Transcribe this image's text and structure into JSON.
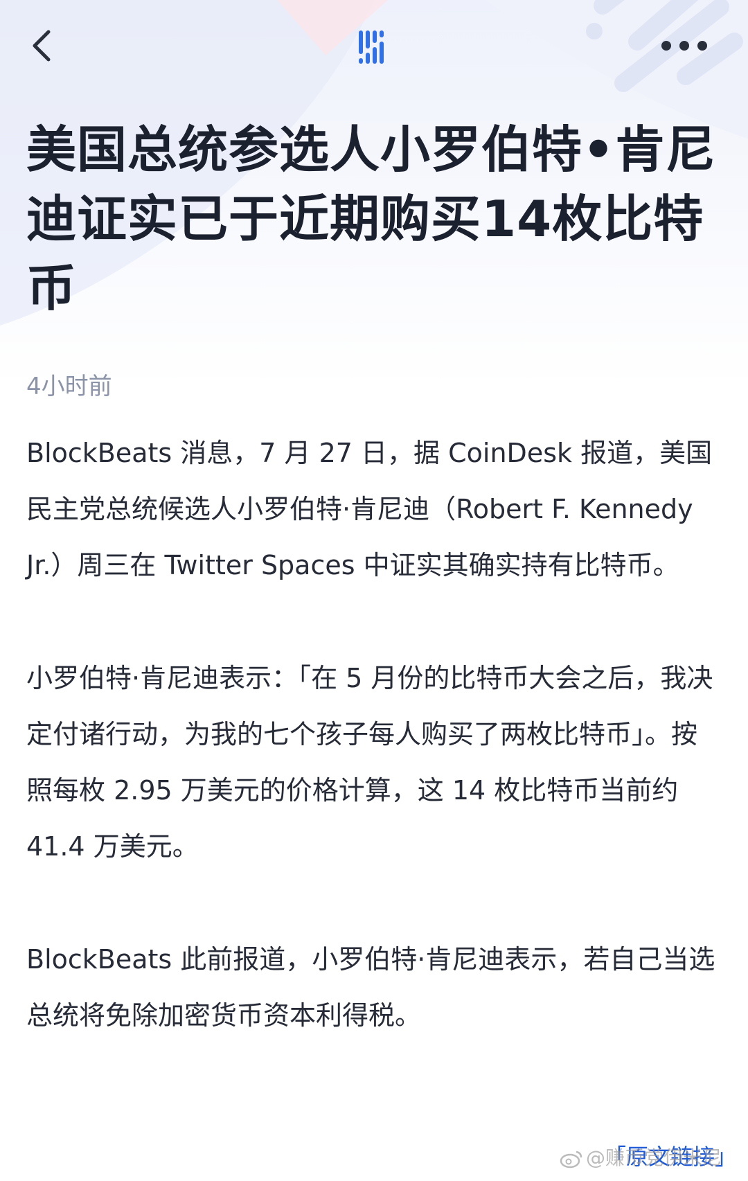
{
  "header": {
    "back_icon": "chevron-left-icon",
    "logo_icon": "blockbeats-logo-icon",
    "more_icon": "ellipsis-icon"
  },
  "article": {
    "title": "美国总统参选人小罗伯特•肯尼迪证实已于近期购买14枚比特币",
    "time": "4小时前",
    "paragraphs": [
      "BlockBeats 消息，7 月 27 日，据 CoinDesk 报道，美国民主党总统候选人小罗伯特·肯尼迪（Robert F. Kennedy Jr.）周三在 Twitter Spaces 中证实其确实持有比特币。",
      "小罗伯特·肯尼迪表示：「在 5 月份的比特币大会之后，我决定付诸行动，为我的七个孩子每人购买了两枚比特币」。按照每枚 2.95 万美元的价格计算，这 14 枚比特币当前约 41.4 万美元。",
      "BlockBeats 此前报道，小罗伯特·肯尼迪表示，若自己当选总统将免除加密货币资本利得税。"
    ],
    "source_link": "「原文链接」"
  },
  "watermark": {
    "text": "@赚币党伊米尼"
  },
  "colors": {
    "accent": "#2f6fe8",
    "title": "#1c2130",
    "meta": "#8b93a8",
    "link": "#1f5bd8"
  }
}
